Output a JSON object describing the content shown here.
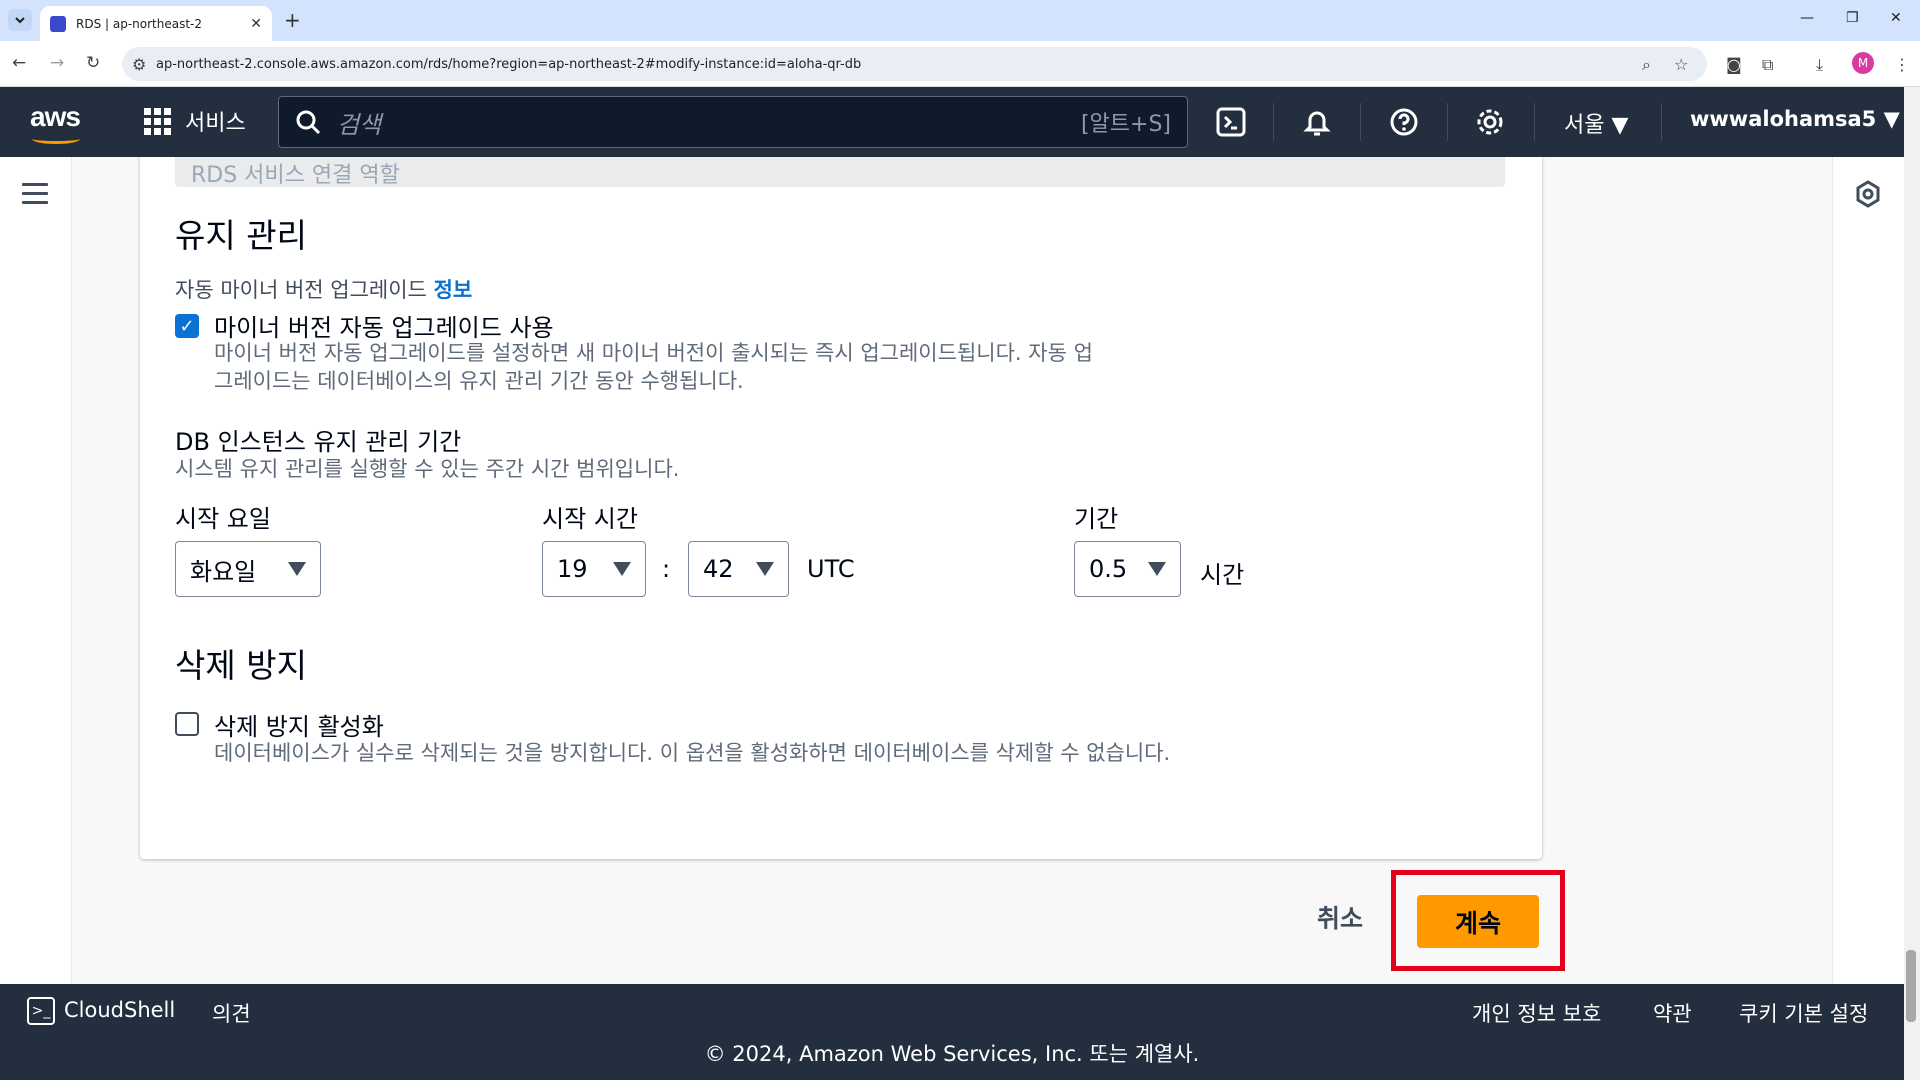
{
  "browser": {
    "tab_title": "RDS | ap-northeast-2",
    "tab_close": "✕",
    "new_tab": "+",
    "url": "ap-northeast-2.console.aws.amazon.com/rds/home?region=ap-northeast-2#modify-instance:id=aloha-qr-db",
    "profile_initial": "M"
  },
  "aws_nav": {
    "logo": "aws",
    "services": "서비스",
    "search_placeholder": "검색",
    "search_shortcut": "[알트+S]",
    "region": "서울 ▼",
    "account": "wwwalohamsa5 ▼"
  },
  "form": {
    "prev_field_text": "RDS 서비스 연결 역할",
    "maintenance": {
      "heading": "유지 관리",
      "auto_upgrade_label": "자동 마이너 버전 업그레이드",
      "info_link": "정보",
      "auto_upgrade_checkbox_label": "마이너 버전 자동 업그레이드 사용",
      "auto_upgrade_checked": true,
      "auto_upgrade_desc_1": "마이너 버전 자동 업그레이드를 설정하면 새 마이너 버전이 출시되는 즉시 업그레이드됩니다. 자동 업",
      "auto_upgrade_desc_2": "그레이드는 데이터베이스의 유지 관리 기간 동안 수행됩니다."
    },
    "window": {
      "title": "DB 인스턴스 유지 관리 기간",
      "desc": "시스템 유지 관리를 실행할 수 있는 주간 시간 범위입니다.",
      "start_day_label": "시작 요일",
      "start_day_value": "화요일",
      "start_time_label": "시작 시간",
      "hour_value": "19",
      "colon": ":",
      "minute_value": "42",
      "timezone": "UTC",
      "duration_label": "기간",
      "duration_value": "0.5",
      "duration_unit": "시간"
    },
    "deletion": {
      "heading": "삭제 방지",
      "checkbox_label": "삭제 방지 활성화",
      "checked": false,
      "desc": "데이터베이스가 실수로 삭제되는 것을 방지합니다. 이 옵션을 활성화하면 데이터베이스를 삭제할 수 없습니다."
    },
    "actions": {
      "cancel": "취소",
      "continue": "계속"
    }
  },
  "footer": {
    "cloudshell": "CloudShell",
    "feedback": "의견",
    "privacy": "개인 정보 보호",
    "terms": "약관",
    "cookies": "쿠키 기본 설정",
    "copyright": "© 2024, Amazon Web Services, Inc. 또는 계열사."
  },
  "colors": {
    "aws_nav_bg": "#232f3e",
    "primary_button": "#ff9900",
    "link": "#0972d3",
    "highlight": "#e3001b"
  }
}
